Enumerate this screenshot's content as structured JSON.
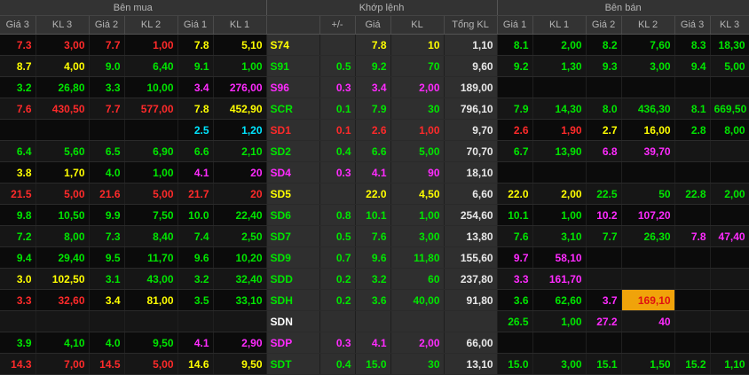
{
  "groups": {
    "bid": "Bên mua",
    "match": "Khớp lệnh",
    "ask": "Bên bán"
  },
  "headers": [
    "Giá 3",
    "KL 3",
    "Giá 2",
    "KL 2",
    "Giá 1",
    "KL 1",
    "+/-",
    "Giá",
    "KL",
    "Tổng KL",
    "Giá 1",
    "KL 1",
    "Giá 2",
    "KL 2",
    "Giá 3",
    "KL 3"
  ],
  "colors": {
    "red": "#ff2a2a",
    "green": "#00e600",
    "yellow": "#ffff00",
    "magenta": "#ff2bff",
    "cyan": "#00e5ff",
    "white": "#ffffff",
    "highlight": "#f0a30a"
  },
  "rows": [
    {
      "sym": "S74",
      "c": "yel",
      "cells": [
        [
          "7.3",
          "red"
        ],
        [
          "3,00",
          "red"
        ],
        [
          "7.7",
          "red"
        ],
        [
          "1,00",
          "red"
        ],
        [
          "7.8",
          "yel"
        ],
        [
          "5,10",
          "yel"
        ],
        [
          "",
          "yel"
        ],
        [
          "7.8",
          "yel"
        ],
        [
          "10",
          "yel"
        ],
        [
          "1,10",
          ""
        ],
        [
          "8.1",
          "grn"
        ],
        [
          "2,00",
          "grn"
        ],
        [
          "8.2",
          "grn"
        ],
        [
          "7,60",
          "grn"
        ],
        [
          "8.3",
          "grn"
        ],
        [
          "18,30",
          "grn"
        ]
      ]
    },
    {
      "sym": "S91",
      "c": "grn",
      "cells": [
        [
          "8.7",
          "yel"
        ],
        [
          "4,00",
          "yel"
        ],
        [
          "9.0",
          "grn"
        ],
        [
          "6,40",
          "grn"
        ],
        [
          "9.1",
          "grn"
        ],
        [
          "1,00",
          "grn"
        ],
        [
          "0.5",
          "grn"
        ],
        [
          "9.2",
          "grn"
        ],
        [
          "70",
          "grn"
        ],
        [
          "9,60",
          ""
        ],
        [
          "9.2",
          "grn"
        ],
        [
          "1,30",
          "grn"
        ],
        [
          "9.3",
          "grn"
        ],
        [
          "3,00",
          "grn"
        ],
        [
          "9.4",
          "grn"
        ],
        [
          "5,00",
          "grn"
        ]
      ]
    },
    {
      "sym": "S96",
      "c": "mag",
      "cells": [
        [
          "3.2",
          "grn"
        ],
        [
          "26,80",
          "grn"
        ],
        [
          "3.3",
          "grn"
        ],
        [
          "10,00",
          "grn"
        ],
        [
          "3.4",
          "mag"
        ],
        [
          "276,00",
          "mag"
        ],
        [
          "0.3",
          "mag"
        ],
        [
          "3.4",
          "mag"
        ],
        [
          "2,00",
          "mag"
        ],
        [
          "189,00",
          ""
        ],
        [
          "",
          ""
        ],
        [
          "",
          ""
        ],
        [
          "",
          ""
        ],
        [
          "",
          ""
        ],
        [
          "",
          ""
        ],
        [
          "",
          ""
        ]
      ]
    },
    {
      "sym": "SCR",
      "c": "grn",
      "cells": [
        [
          "7.6",
          "red"
        ],
        [
          "430,50",
          "red"
        ],
        [
          "7.7",
          "red"
        ],
        [
          "577,00",
          "red"
        ],
        [
          "7.8",
          "yel"
        ],
        [
          "452,90",
          "yel"
        ],
        [
          "0.1",
          "grn"
        ],
        [
          "7.9",
          "grn"
        ],
        [
          "30",
          "grn"
        ],
        [
          "796,10",
          ""
        ],
        [
          "7.9",
          "grn"
        ],
        [
          "14,30",
          "grn"
        ],
        [
          "8.0",
          "grn"
        ],
        [
          "436,30",
          "grn"
        ],
        [
          "8.1",
          "grn"
        ],
        [
          "669,50",
          "grn"
        ]
      ]
    },
    {
      "sym": "SD1",
      "c": "red",
      "cells": [
        [
          "",
          ""
        ],
        [
          "",
          ""
        ],
        [
          "",
          ""
        ],
        [
          "",
          ""
        ],
        [
          "2.5",
          "cyn"
        ],
        [
          "1,20",
          "cyn"
        ],
        [
          "0.1",
          "red"
        ],
        [
          "2.6",
          "red"
        ],
        [
          "1,00",
          "red"
        ],
        [
          "9,70",
          ""
        ],
        [
          "2.6",
          "red"
        ],
        [
          "1,90",
          "red"
        ],
        [
          "2.7",
          "yel"
        ],
        [
          "16,00",
          "yel"
        ],
        [
          "2.8",
          "grn"
        ],
        [
          "8,00",
          "grn"
        ]
      ]
    },
    {
      "sym": "SD2",
      "c": "grn",
      "cells": [
        [
          "6.4",
          "grn"
        ],
        [
          "5,60",
          "grn"
        ],
        [
          "6.5",
          "grn"
        ],
        [
          "6,90",
          "grn"
        ],
        [
          "6.6",
          "grn"
        ],
        [
          "2,10",
          "grn"
        ],
        [
          "0.4",
          "grn"
        ],
        [
          "6.6",
          "grn"
        ],
        [
          "5,00",
          "grn"
        ],
        [
          "70,70",
          ""
        ],
        [
          "6.7",
          "grn"
        ],
        [
          "13,90",
          "grn"
        ],
        [
          "6.8",
          "mag"
        ],
        [
          "39,70",
          "mag"
        ],
        [
          "",
          ""
        ],
        [
          "",
          ""
        ]
      ]
    },
    {
      "sym": "SD4",
      "c": "mag",
      "cells": [
        [
          "3.8",
          "yel"
        ],
        [
          "1,70",
          "yel"
        ],
        [
          "4.0",
          "grn"
        ],
        [
          "1,00",
          "grn"
        ],
        [
          "4.1",
          "mag"
        ],
        [
          "20",
          "mag"
        ],
        [
          "0.3",
          "mag"
        ],
        [
          "4.1",
          "mag"
        ],
        [
          "90",
          "mag"
        ],
        [
          "18,10",
          ""
        ],
        [
          "",
          ""
        ],
        [
          "",
          ""
        ],
        [
          "",
          ""
        ],
        [
          "",
          ""
        ],
        [
          "",
          ""
        ],
        [
          "",
          ""
        ]
      ]
    },
    {
      "sym": "SD5",
      "c": "yel",
      "cells": [
        [
          "21.5",
          "red"
        ],
        [
          "5,00",
          "red"
        ],
        [
          "21.6",
          "red"
        ],
        [
          "5,00",
          "red"
        ],
        [
          "21.7",
          "red"
        ],
        [
          "20",
          "red"
        ],
        [
          "",
          "yel"
        ],
        [
          "22.0",
          "yel"
        ],
        [
          "4,50",
          "yel"
        ],
        [
          "6,60",
          ""
        ],
        [
          "22.0",
          "yel"
        ],
        [
          "2,00",
          "yel"
        ],
        [
          "22.5",
          "grn"
        ],
        [
          "50",
          "grn"
        ],
        [
          "22.8",
          "grn"
        ],
        [
          "2,00",
          "grn"
        ]
      ]
    },
    {
      "sym": "SD6",
      "c": "grn",
      "cells": [
        [
          "9.8",
          "grn"
        ],
        [
          "10,50",
          "grn"
        ],
        [
          "9.9",
          "grn"
        ],
        [
          "7,50",
          "grn"
        ],
        [
          "10.0",
          "grn"
        ],
        [
          "22,40",
          "grn"
        ],
        [
          "0.8",
          "grn"
        ],
        [
          "10.1",
          "grn"
        ],
        [
          "1,00",
          "grn"
        ],
        [
          "254,60",
          ""
        ],
        [
          "10.1",
          "grn"
        ],
        [
          "1,00",
          "grn"
        ],
        [
          "10.2",
          "mag"
        ],
        [
          "107,20",
          "mag"
        ],
        [
          "",
          ""
        ],
        [
          "",
          ""
        ]
      ]
    },
    {
      "sym": "SD7",
      "c": "grn",
      "cells": [
        [
          "7.2",
          "grn"
        ],
        [
          "8,00",
          "grn"
        ],
        [
          "7.3",
          "grn"
        ],
        [
          "8,40",
          "grn"
        ],
        [
          "7.4",
          "grn"
        ],
        [
          "2,50",
          "grn"
        ],
        [
          "0.5",
          "grn"
        ],
        [
          "7.6",
          "grn"
        ],
        [
          "3,00",
          "grn"
        ],
        [
          "13,80",
          ""
        ],
        [
          "7.6",
          "grn"
        ],
        [
          "3,10",
          "grn"
        ],
        [
          "7.7",
          "grn"
        ],
        [
          "26,30",
          "grn"
        ],
        [
          "7.8",
          "mag"
        ],
        [
          "47,40",
          "mag"
        ]
      ]
    },
    {
      "sym": "SD9",
      "c": "grn",
      "cells": [
        [
          "9.4",
          "grn"
        ],
        [
          "29,40",
          "grn"
        ],
        [
          "9.5",
          "grn"
        ],
        [
          "11,70",
          "grn"
        ],
        [
          "9.6",
          "grn"
        ],
        [
          "10,20",
          "grn"
        ],
        [
          "0.7",
          "grn"
        ],
        [
          "9.6",
          "grn"
        ],
        [
          "11,80",
          "grn"
        ],
        [
          "155,60",
          ""
        ],
        [
          "9.7",
          "mag"
        ],
        [
          "58,10",
          "mag"
        ],
        [
          "",
          ""
        ],
        [
          "",
          ""
        ],
        [
          "",
          ""
        ],
        [
          "",
          ""
        ]
      ]
    },
    {
      "sym": "SDD",
      "c": "grn",
      "cells": [
        [
          "3.0",
          "yel"
        ],
        [
          "102,50",
          "yel"
        ],
        [
          "3.1",
          "grn"
        ],
        [
          "43,00",
          "grn"
        ],
        [
          "3.2",
          "grn"
        ],
        [
          "32,40",
          "grn"
        ],
        [
          "0.2",
          "grn"
        ],
        [
          "3.2",
          "grn"
        ],
        [
          "60",
          "grn"
        ],
        [
          "237,80",
          ""
        ],
        [
          "3.3",
          "mag"
        ],
        [
          "161,70",
          "mag"
        ],
        [
          "",
          ""
        ],
        [
          "",
          ""
        ],
        [
          "",
          ""
        ],
        [
          "",
          ""
        ]
      ]
    },
    {
      "sym": "SDH",
      "c": "grn",
      "cells": [
        [
          "3.3",
          "red"
        ],
        [
          "32,60",
          "red"
        ],
        [
          "3.4",
          "yel"
        ],
        [
          "81,00",
          "yel"
        ],
        [
          "3.5",
          "grn"
        ],
        [
          "33,10",
          "grn"
        ],
        [
          "0.2",
          "grn"
        ],
        [
          "3.6",
          "grn"
        ],
        [
          "40,00",
          "grn"
        ],
        [
          "91,80",
          ""
        ],
        [
          "3.6",
          "grn"
        ],
        [
          "62,60",
          "grn"
        ],
        [
          "3.7",
          "mag"
        ],
        [
          "169,10",
          "hl"
        ],
        [
          "",
          ""
        ],
        [
          "",
          ""
        ]
      ]
    },
    {
      "sym": "SDN",
      "c": "wht",
      "cells": [
        [
          "",
          ""
        ],
        [
          "",
          ""
        ],
        [
          "",
          ""
        ],
        [
          "",
          ""
        ],
        [
          "",
          ""
        ],
        [
          "",
          ""
        ],
        [
          "",
          ""
        ],
        [
          "",
          ""
        ],
        [
          "",
          ""
        ],
        [
          "",
          ""
        ],
        [
          "26.5",
          "grn"
        ],
        [
          "1,00",
          "grn"
        ],
        [
          "27.2",
          "mag"
        ],
        [
          "40",
          "mag"
        ],
        [
          "",
          ""
        ],
        [
          "",
          ""
        ]
      ]
    },
    {
      "sym": "SDP",
      "c": "mag",
      "cells": [
        [
          "3.9",
          "grn"
        ],
        [
          "4,10",
          "grn"
        ],
        [
          "4.0",
          "grn"
        ],
        [
          "9,50",
          "grn"
        ],
        [
          "4.1",
          "mag"
        ],
        [
          "2,90",
          "mag"
        ],
        [
          "0.3",
          "mag"
        ],
        [
          "4.1",
          "mag"
        ],
        [
          "2,00",
          "mag"
        ],
        [
          "66,00",
          ""
        ],
        [
          "",
          ""
        ],
        [
          "",
          ""
        ],
        [
          "",
          ""
        ],
        [
          "",
          ""
        ],
        [
          "",
          ""
        ],
        [
          "",
          ""
        ]
      ]
    },
    {
      "sym": "SDT",
      "c": "grn",
      "cells": [
        [
          "14.3",
          "red"
        ],
        [
          "7,00",
          "red"
        ],
        [
          "14.5",
          "red"
        ],
        [
          "5,00",
          "red"
        ],
        [
          "14.6",
          "yel"
        ],
        [
          "9,50",
          "yel"
        ],
        [
          "0.4",
          "grn"
        ],
        [
          "15.0",
          "grn"
        ],
        [
          "30",
          "grn"
        ],
        [
          "13,10",
          ""
        ],
        [
          "15.0",
          "grn"
        ],
        [
          "3,00",
          "grn"
        ],
        [
          "15.1",
          "grn"
        ],
        [
          "1,50",
          "grn"
        ],
        [
          "15.2",
          "grn"
        ],
        [
          "1,10",
          "grn"
        ]
      ]
    }
  ]
}
